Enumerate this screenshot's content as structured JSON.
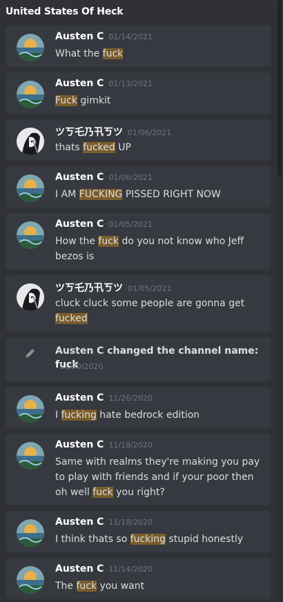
{
  "channel": {
    "title": "United States Of Heck"
  },
  "messages": [
    {
      "author": "Austen C",
      "date": "01/14/2021",
      "avatar": "landscape",
      "parts": [
        "What the ",
        "fuck",
        ""
      ]
    },
    {
      "author": "Austen C",
      "date": "01/13/2021",
      "avatar": "landscape",
      "parts": [
        "",
        "Fuck",
        " gimkit"
      ]
    },
    {
      "author": "ツㄎ乇乃卂ㄎツ",
      "date": "01/06/2021",
      "avatar": "anime",
      "parts": [
        "thats ",
        "fucked",
        " UP"
      ]
    },
    {
      "author": "Austen C",
      "date": "01/06/2021",
      "avatar": "landscape",
      "parts": [
        "I AM ",
        "FUCKING",
        " PISSED RIGHT NOW"
      ]
    },
    {
      "author": "Austen C",
      "date": "01/05/2021",
      "avatar": "landscape",
      "parts": [
        "How the ",
        "fuck",
        " do you not know who Jeff bezos is"
      ]
    },
    {
      "author": "ツㄎ乇乃卂ㄎツ",
      "date": "01/05/2021",
      "avatar": "anime",
      "parts": [
        "cluck cluck some people are gonna get ",
        "fucked",
        ""
      ]
    },
    {
      "author": "Austen C",
      "date": "11/26/2020",
      "avatar": "landscape",
      "parts": [
        "I ",
        "fucking",
        " hate bedrock edition"
      ]
    },
    {
      "author": "Austen C",
      "date": "11/18/2020",
      "avatar": "landscape",
      "parts": [
        "Same with realms they're making you pay to play with friends and if your poor then oh well ",
        "fuck",
        " you right?"
      ]
    },
    {
      "author": "Austen C",
      "date": "11/18/2020",
      "avatar": "landscape",
      "parts": [
        "I think thats so ",
        "fucking",
        " stupid honestly"
      ]
    },
    {
      "author": "Austen C",
      "date": "11/14/2020",
      "avatar": "landscape",
      "parts": [
        "The ",
        "fuck",
        " you want"
      ]
    }
  ],
  "system_event": {
    "author": "Austen C",
    "text": " changed the channel name: ",
    "channel_name": "fuck",
    "date": "11/30/2020",
    "icon": "pencil-icon"
  },
  "colors": {
    "background": "#2f3136",
    "card": "#36393f",
    "highlight": "#7b5d2c",
    "timestamp": "#72767d"
  }
}
